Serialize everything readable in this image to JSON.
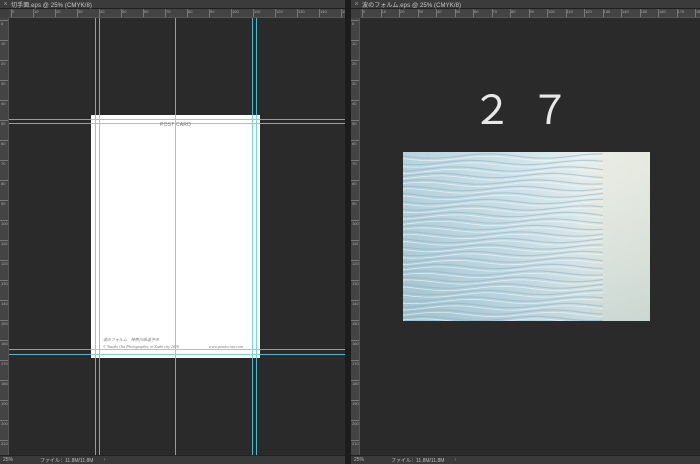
{
  "left_doc": {
    "tab_title": "切手面.eps @ 25% (CMYK/8)",
    "close_glyph": "×",
    "ruler_h_labels": [
      "0",
      "10",
      "20",
      "30",
      "40",
      "50",
      "60",
      "70",
      "80",
      "90",
      "100",
      "110",
      "120",
      "130",
      "140",
      "150"
    ],
    "ruler_v_labels": [
      "0",
      "10",
      "20",
      "30",
      "40",
      "50",
      "60",
      "70",
      "80",
      "90",
      "100",
      "110",
      "120",
      "130",
      "140",
      "150",
      "160",
      "170",
      "180",
      "190",
      "200",
      "210"
    ],
    "postcard": {
      "title": "POST CARD",
      "caption_line1": "波のフォルム　神奈川県逗子市",
      "caption_line2": "© Yasuko Ota Photographer, in Zushi city 2016",
      "website": "www.yasuko-ota.com"
    },
    "status": {
      "zoom": "25%",
      "file_info": "ファイル：11.8M/11.8M",
      "arrow": "›"
    }
  },
  "right_doc": {
    "tab_title": "波のフォルム.eps @ 25% (CMYK/8)",
    "close_glyph": "×",
    "ruler_h_labels": [
      "0",
      "10",
      "20",
      "30",
      "40",
      "50",
      "60",
      "70",
      "80",
      "90",
      "100",
      "110",
      "120",
      "130",
      "140",
      "150",
      "160",
      "170",
      "180"
    ],
    "ruler_v_labels": [
      "0",
      "10",
      "20",
      "30",
      "40",
      "50",
      "60",
      "70",
      "80",
      "90",
      "100",
      "110",
      "120",
      "130",
      "140",
      "150",
      "160",
      "170",
      "180",
      "190",
      "200",
      "210"
    ],
    "number_text": "２７",
    "photo_icon": "water-photo",
    "status": {
      "zoom": "25%",
      "file_info": "ファイル：11.8M/11.8M",
      "arrow": "›"
    }
  },
  "colors": {
    "guide": "#4fb8c9",
    "canvas": "#2a2a2a",
    "paper": "#ffffff"
  }
}
